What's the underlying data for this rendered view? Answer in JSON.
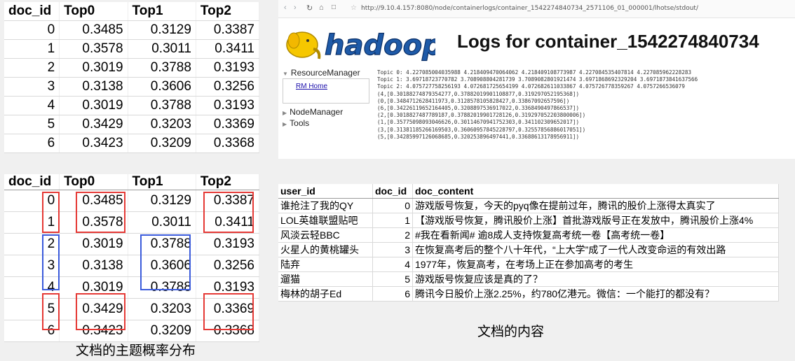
{
  "table_top": {
    "headers": [
      "doc_id",
      "Top0",
      "Top1",
      "Top2"
    ],
    "rows": [
      [
        "0",
        "0.3485",
        "0.3129",
        "0.3387"
      ],
      [
        "1",
        "0.3578",
        "0.3011",
        "0.3411"
      ],
      [
        "2",
        "0.3019",
        "0.3788",
        "0.3193"
      ],
      [
        "3",
        "0.3138",
        "0.3606",
        "0.3256"
      ],
      [
        "4",
        "0.3019",
        "0.3788",
        "0.3193"
      ],
      [
        "5",
        "0.3429",
        "0.3203",
        "0.3369"
      ],
      [
        "6",
        "0.3423",
        "0.3209",
        "0.3368"
      ]
    ]
  },
  "table_highlighted": {
    "headers": [
      "doc_id",
      "Top0",
      "Top1",
      "Top2"
    ],
    "rows": [
      [
        "0",
        "0.3485",
        "0.3129",
        "0.3387"
      ],
      [
        "1",
        "0.3578",
        "0.3011",
        "0.3411"
      ],
      [
        "2",
        "0.3019",
        "0.3788",
        "0.3193"
      ],
      [
        "3",
        "0.3138",
        "0.3606",
        "0.3256"
      ],
      [
        "4",
        "0.3019",
        "0.3788",
        "0.3193"
      ],
      [
        "5",
        "0.3429",
        "0.3203",
        "0.3369"
      ],
      [
        "6",
        "0.3423",
        "0.3209",
        "0.3368"
      ]
    ],
    "highlight_colors": {
      "red": "#e53935",
      "blue": "#3b5bdb"
    }
  },
  "caption_left": "文档的主题概率分布",
  "browser": {
    "nav_icons": [
      "back-icon",
      "forward-icon",
      "reload-icon",
      "home-icon",
      "reader-icon",
      "star-icon"
    ],
    "url": "http://9.10.4.157:8080/node/containerlogs/container_1542274840734_2571106_01_000001/lhotse/stdout/",
    "logo_text": "hadoop",
    "title": "Logs for container_1542274840734",
    "sidebar": {
      "resource_manager": "ResourceManager",
      "rm_home": "RM Home",
      "node_manager": "NodeManager",
      "tools": "Tools"
    },
    "log_lines": [
      "Topic 0: 4.227085004035988 4.218409470064062 4.218409108773987 4.227084535407814 4.227085962228283",
      "Topic 1: 3.69718723770782 3.708908804281739 3.7089082801921474 3.6971868692329204 3.6971873841637566",
      "Topic 2: 4.075727758256193 4.072681725654199 4.072682611033867 4.075726778359267 4.0757266536079",
      "(4,[0.30188274879354277,0.37882019901108877,0.319297052195368])",
      "(0,[0.3484712628411973,0.3128578105828427,0.33867092657596])",
      "(6,[0.34226119652164405,0.3208897536917022,0.3368490497866537])",
      "(2,[0.3018827487789187,0.37882019901728126,0.319297052203800006])",
      "(1,[0.35775098093046626,0.30114670941752303,0.341102309652017])",
      "(3,[0.31381185266169503,0.36060957845228797,0.32557856886017051])",
      "(5,[0.34285997126068685,0.320253896497441,0.33688613178956911])"
    ]
  },
  "table_users": {
    "headers": [
      "user_id",
      "doc_id",
      "doc_content"
    ],
    "rows": [
      [
        "谁抢注了我的QY",
        "0",
        "游戏版号恢复，今天的pyq像在提前过年，腾讯的股价上涨得太真实了"
      ],
      [
        "LOL英雄联盟贴吧",
        "1",
        "【游戏版号恢复，腾讯股价上涨】首批游戏版号正在发放中，腾讯股价上涨4%"
      ],
      [
        "风淡云轻BBC",
        "2",
        "#我在看新闻# 逾8成人支持恢复高考统一卷【高考统一卷】"
      ],
      [
        "火星人的黄桃罐头",
        "3",
        "在恢复高考后的整个八十年代，“上大学”成了一代人改变命运的有效出路"
      ],
      [
        "陆弃",
        "4",
        "1977年，恢复高考，在考场上正在参加高考的考生"
      ],
      [
        "遛猫",
        "5",
        "游戏版号恢复应该是真的了？"
      ],
      [
        "梅林的胡子Ed",
        "6",
        "腾讯今日股价上涨2.25%，约780亿港元。微信：一个能打的都没有？"
      ]
    ]
  },
  "caption_right": "文档的内容"
}
